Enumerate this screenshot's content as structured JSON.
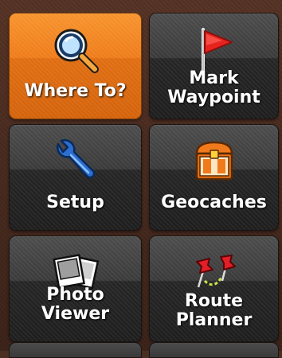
{
  "menu": {
    "tiles": [
      {
        "label_line1": "Where To?",
        "label_line2": "",
        "icon": "magnifier-icon",
        "active": true
      },
      {
        "label_line1": "Mark",
        "label_line2": "Waypoint",
        "icon": "flag-icon",
        "active": false
      },
      {
        "label_line1": "Setup",
        "label_line2": "",
        "icon": "wrench-icon",
        "active": false
      },
      {
        "label_line1": "Geocaches",
        "label_line2": "",
        "icon": "treasure-chest-icon",
        "active": false
      },
      {
        "label_line1": "Photo Viewer",
        "label_line2": "",
        "icon": "photos-icon",
        "active": false
      },
      {
        "label_line1": "Route",
        "label_line2": "Planner",
        "icon": "pushpins-icon",
        "active": false
      }
    ]
  },
  "colors": {
    "active_tile": "#ef7c1a",
    "tile": "#3a3a3a",
    "background": "#4a2e22"
  }
}
